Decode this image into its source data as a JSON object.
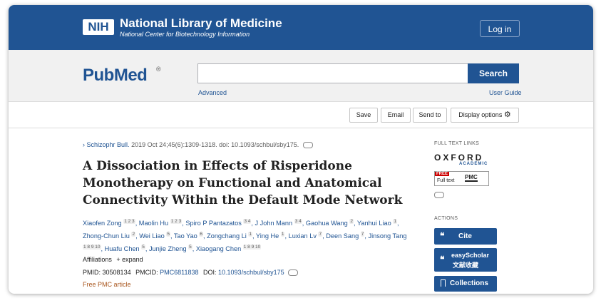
{
  "header": {
    "logo": "NIH",
    "title": "National Library of Medicine",
    "subtitle": "National Center for Biotechnology Information",
    "login_label": "Log in"
  },
  "search": {
    "logo_left": "Pub",
    "logo_right": "ed",
    "logo_mark": "M",
    "registered": "®",
    "value": "",
    "button_label": "Search",
    "advanced_label": "Advanced",
    "guide_label": "User Guide"
  },
  "toolbar": {
    "save": "Save",
    "email": "Email",
    "send_to": "Send to",
    "display": "Display options"
  },
  "article": {
    "journal_chevron": "›",
    "journal": "Schizophr Bull.",
    "citation": "2019 Oct 24;45(6):1309-1318. doi: 10.1093/schbul/sby175.",
    "title": "A Dissociation in Effects of Risperidone Monotherapy on Functional and Anatomical Connectivity Within the Default Mode Network",
    "authors": [
      {
        "name": "Xiaofen Zong",
        "aff": "1 2 3"
      },
      {
        "name": "Maolin Hu",
        "aff": "1 2 3"
      },
      {
        "name": "Spiro P Pantazatos",
        "aff": "3 4"
      },
      {
        "name": "J John Mann",
        "aff": "3 4"
      },
      {
        "name": "Gaohua Wang",
        "aff": "2"
      },
      {
        "name": "Yanhui Liao",
        "aff": "1"
      },
      {
        "name": "Zhong-Chun Liu",
        "aff": "2"
      },
      {
        "name": "Wei Liao",
        "aff": "5"
      },
      {
        "name": "Tao Yao",
        "aff": "6"
      },
      {
        "name": "Zongchang Li",
        "aff": "1"
      },
      {
        "name": "Ying He",
        "aff": "1"
      },
      {
        "name": "Luxian Lv",
        "aff": "7"
      },
      {
        "name": "Deen Sang",
        "aff": "7"
      },
      {
        "name": "Jinsong Tang",
        "aff": "1 8 9 10"
      },
      {
        "name": "Huafu Chen",
        "aff": "5"
      },
      {
        "name": "Junjie Zheng",
        "aff": "5"
      },
      {
        "name": "Xiaogang Chen",
        "aff": "1 8 9 10"
      }
    ],
    "affiliations_label": "Affiliations",
    "expand_label": "+ expand",
    "pmid_label": "PMID:",
    "pmid": "30508134",
    "pmcid_label": "PMCID:",
    "pmcid": "PMC6811838",
    "doi_label": "DOI:",
    "doi": "10.1093/schbul/sby175",
    "free_pmc": "Free PMC article"
  },
  "sidebar": {
    "full_text_links": "FULL TEXT LINKS",
    "oxford": "OXFORD",
    "academic": "ACADEMIC",
    "free_badge": "FREE",
    "full_text": "Full text",
    "pmc": "PMC",
    "actions": "ACTIONS",
    "cite": "Cite",
    "easyscholar": "easyScholar",
    "easyscholar_sub": "文献收藏",
    "collections": "Collections"
  },
  "colors": {
    "nih_blue": "#205493",
    "free_pmc_orange": "#a8551d"
  }
}
